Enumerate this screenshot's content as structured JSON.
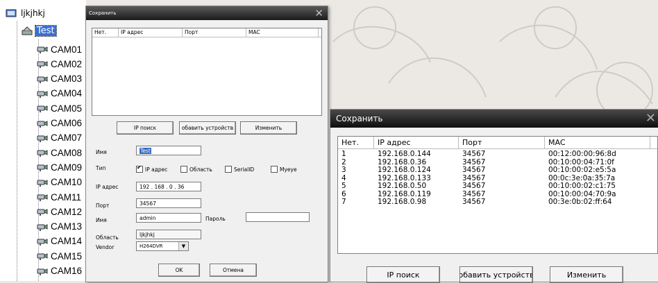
{
  "tree": {
    "root_label": "ljkjhkj",
    "group_label": "Test",
    "cameras": [
      "CAM01",
      "CAM02",
      "CAM03",
      "CAM04",
      "CAM05",
      "CAM06",
      "CAM07",
      "CAM08",
      "CAM09",
      "CAM10",
      "CAM11",
      "CAM12",
      "CAM13",
      "CAM14",
      "CAM15",
      "CAM16"
    ]
  },
  "dialog_small": {
    "title": "Сохранить",
    "close": "✕",
    "columns": [
      "Нет.",
      "IP адрес",
      "Порт",
      "MAC"
    ],
    "buttons": {
      "ip_search": "IP поиск",
      "add_device": "обавить устройств",
      "change": "Изменить"
    },
    "form": {
      "name_label": "Имя",
      "name_value": "Test",
      "type_label": "Тип",
      "type_options": [
        {
          "label": "IP адрес",
          "checked": true
        },
        {
          "label": "Область",
          "checked": false
        },
        {
          "label": "SerialID",
          "checked": false
        },
        {
          "label": "Myeye",
          "checked": false
        }
      ],
      "ip_label": "IP адрес",
      "ip_value": "192 . 168 . 0 . 36",
      "port_label": "Порт",
      "port_value": "34567",
      "user_label": "Имя",
      "user_value": "admin",
      "password_label": "Пароль",
      "password_value": "",
      "area_label": "Область",
      "area_value": "ljkjhkj",
      "vendor_label": "Vendor",
      "vendor_value": "H264DVR",
      "ok": "OK",
      "cancel": "Отмена"
    }
  },
  "dialog_large": {
    "title": "Сохранить",
    "close": "✕",
    "columns": [
      "Нет.",
      "IP адрес",
      "Порт",
      "MAC"
    ],
    "rows": [
      [
        "1",
        "192.168.0.144",
        "34567",
        "00:12:00:00:96:8d"
      ],
      [
        "2",
        "192.168.0.36",
        "34567",
        "00:10:00:04:71:0f"
      ],
      [
        "3",
        "192.168.0.124",
        "34567",
        "00:10:00:02:e5:5a"
      ],
      [
        "4",
        "192.168.0.133",
        "34567",
        "00:0c:3e:0a:35:7a"
      ],
      [
        "5",
        "192.168.0.50",
        "34567",
        "00:10:00:02:c1:75"
      ],
      [
        "6",
        "192.168.0.119",
        "34567",
        "00:10:00:04:70:9a"
      ],
      [
        "7",
        "192.168.0.98",
        "34567",
        "00:3e:0b:02:ff:64"
      ]
    ],
    "buttons": {
      "ip_search": "IP поиск",
      "add_device": "обавить устройств",
      "change": "Изменить"
    }
  }
}
